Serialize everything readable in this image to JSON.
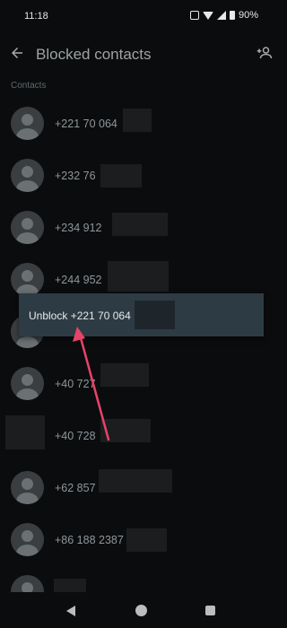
{
  "status_bar": {
    "time": "11:18",
    "battery": "90%"
  },
  "app_bar": {
    "title": "Blocked contacts"
  },
  "section_label": "Contacts",
  "contacts": [
    {
      "number": "+221 70 064"
    },
    {
      "number": "+232 76"
    },
    {
      "number": "+234 912"
    },
    {
      "number": "+244 952"
    },
    {
      "number": ""
    },
    {
      "number": "+40 727"
    },
    {
      "number": "+40 728"
    },
    {
      "number": "+62 857"
    },
    {
      "number": "+86 188 2387"
    },
    {
      "number": ""
    }
  ],
  "popup": {
    "label": "Unblock +221 70 064"
  },
  "annotation": {
    "arrow_color": "#e8436a"
  },
  "icons": [
    "back-arrow-icon",
    "add-contact-icon",
    "avatar-icon",
    "nav-back-icon",
    "nav-home-icon",
    "nav-recents-icon"
  ]
}
